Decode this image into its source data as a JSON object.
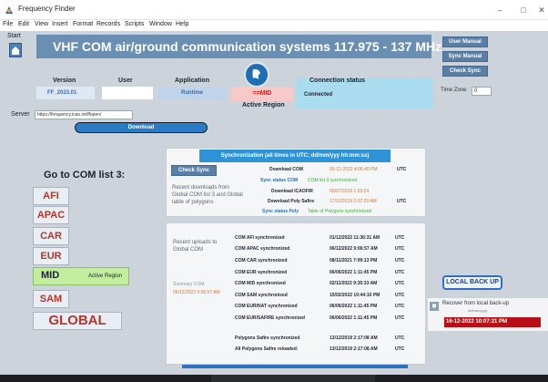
{
  "window": {
    "title": "Frequency Finder",
    "minimize": "–",
    "maximize": "□",
    "close": "✕"
  },
  "menu": [
    "File",
    "Edit",
    "View",
    "Insert",
    "Format",
    "Records",
    "Scripts",
    "Window",
    "Help"
  ],
  "start_label": "Start",
  "banner": "VHF COM air/ground communication systems 117.975 - 137 MHz",
  "side_buttons": {
    "user_manual": "User Manual",
    "sync_manual": "Sync Manual",
    "check_sync": "Check Sync"
  },
  "headers": {
    "version": "Version",
    "user": "User",
    "application": "Application",
    "connection": "Connection status"
  },
  "values": {
    "version": "FF_2023.01",
    "user": "",
    "application": "Runtime",
    "region": "==MID",
    "connection": "Connected"
  },
  "active_region_label": "Active Region",
  "timezone": {
    "label": "Time Zone",
    "value": "0"
  },
  "server": {
    "label": "Server",
    "value": "https://frequency.icao.int/ffopen/"
  },
  "download_label": "Download",
  "goto_label": "Go to COM list 3:",
  "regions": [
    "AFI",
    "APAC",
    "CAR",
    "EUR",
    "MID",
    "SAM",
    "GLOBAL"
  ],
  "mid_active_label": "Active Region",
  "sync": {
    "header": "Synchronization (all times in UTC; dd/mm/yyy hh:mm:ss)",
    "check_btn": "Check Sync",
    "recent_label": "Recent downloads from Global COM list 3 and Global table of polygons",
    "rows": [
      {
        "label": "Download COM",
        "value": "06-12-2022 4:06:49 PM",
        "utc": "UTC"
      },
      {
        "label": "Sync status COM",
        "value": "COM list 3 synchronized",
        "utc": ""
      },
      {
        "label": "Download ICAOFIR",
        "value": "05/07/2018 1:33:24",
        "utc": ""
      },
      {
        "label": "Download Poly Safire",
        "value": "17/12/2019 2:07:29 AM",
        "utc": "UTC"
      },
      {
        "label": "Sync status Poly",
        "value": "Table of Polygons synchronized",
        "utc": ""
      }
    ]
  },
  "uploads": {
    "label": "Recent uploads to Global COM",
    "summary_label": "Summary COM",
    "summary_date": "06/12/2022 9:06:57 AM",
    "rows": [
      {
        "label": "COM AFI synchronized",
        "value": "01/12/2022 11:36:31 AM",
        "utc": "UTC"
      },
      {
        "label": "COM APAC synchronized",
        "value": "06/12/2022 9:06:57 AM",
        "utc": "UTC"
      },
      {
        "label": "COM CAR synchronized",
        "value": "08/11/2021 7:09:13 PM",
        "utc": "UTC"
      },
      {
        "label": "COM EUR synchronized",
        "value": "06/06/2022 1:11:45 PM",
        "utc": "UTC"
      },
      {
        "label": "COM MID synchronized",
        "value": "02/11/2022 9:35:33 AM",
        "utc": "UTC"
      },
      {
        "label": "COM SAM synchronized",
        "value": "15/02/2022 10:44:10 PM",
        "utc": "UTC"
      },
      {
        "label": "COM EUR/NAT synchronized",
        "value": "06/06/2022 1:11:45 PM",
        "utc": "UTC"
      },
      {
        "label": "COM EUR/SAFIRE synchronized",
        "value": "06/06/2022 1:11:45 PM",
        "utc": "UTC"
      },
      {
        "label": "Polygons Safire synchronized",
        "value": "13/12/2019 2:17:08 AM",
        "utc": "UTC"
      },
      {
        "label": "All Polygons Safire reloaded:",
        "value": "13/12/2019 2:17:08 AM",
        "utc": "UTC"
      }
    ]
  },
  "local_backup_label": "LOCAL BACK UP",
  "recover": {
    "label": "Recover from local back-up",
    "format": "dd/mm/yyyy",
    "date": "16-12-2022 10:07:21 PM"
  },
  "colors": {
    "banner": "#6b8fb2",
    "button": "#5a7fa6",
    "sync_header": "#2f93d8",
    "region_text": "#b3362c",
    "active_region": "#c3ee9f",
    "connection_bg": "#a8dcee",
    "recover_date": "#b80e16"
  }
}
